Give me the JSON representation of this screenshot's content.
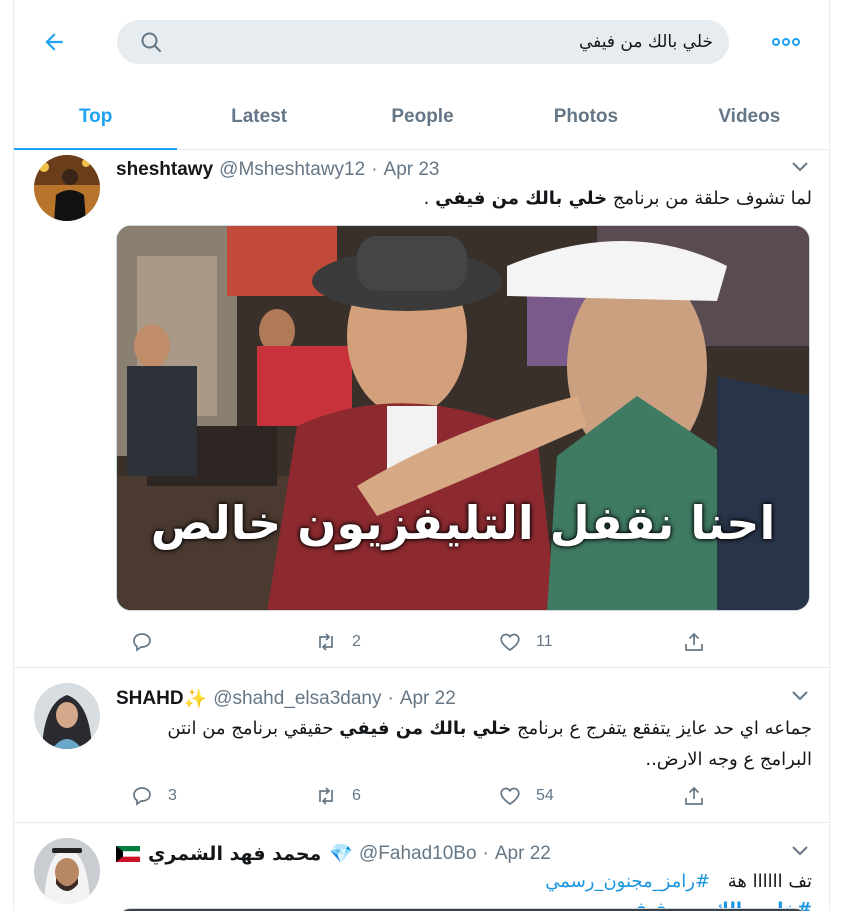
{
  "search": {
    "query": "خلي بالك من فيفي"
  },
  "tabs": [
    {
      "label": "Top"
    },
    {
      "label": "Latest"
    },
    {
      "label": "People"
    },
    {
      "label": "Photos"
    },
    {
      "label": "Videos"
    }
  ],
  "tweets": [
    {
      "name": "sheshtawy",
      "handle": "@Msheshtawy12",
      "sep": "·",
      "date": "Apr 23",
      "text_pre": "لما تشوف حلقة من برنامج ",
      "text_bold": "خلي بالك من فيفي",
      "text_post": " .",
      "image_caption": "احنا نقفل التليفزيون خالص",
      "replies": "",
      "retweets": "2",
      "likes": "11"
    },
    {
      "name": "SHAHD",
      "name_emoji": "✨",
      "handle": "@shahd_elsa3dany",
      "sep": "·",
      "date": "Apr 22",
      "text_pre": "جماعه اي حد عايز يتفقع يتفرج ع برنامج ",
      "text_bold": "خلي بالك من فيفي",
      "text_post": " حقيقي برنامج من انتن البرامج ع وجه الارض..",
      "replies": "3",
      "retweets": "6",
      "likes": "54"
    },
    {
      "name": "محمد فهد الشمري",
      "name_emoji": "💎",
      "handle": "@Fahad10Bo",
      "sep": "·",
      "date": "Apr 22",
      "text_plain": "تف اااااا هة",
      "hashtag1": "#رامز_مجنون_رسمي",
      "hashtag2": "#خلي_بالك_من_فيفي"
    }
  ]
}
